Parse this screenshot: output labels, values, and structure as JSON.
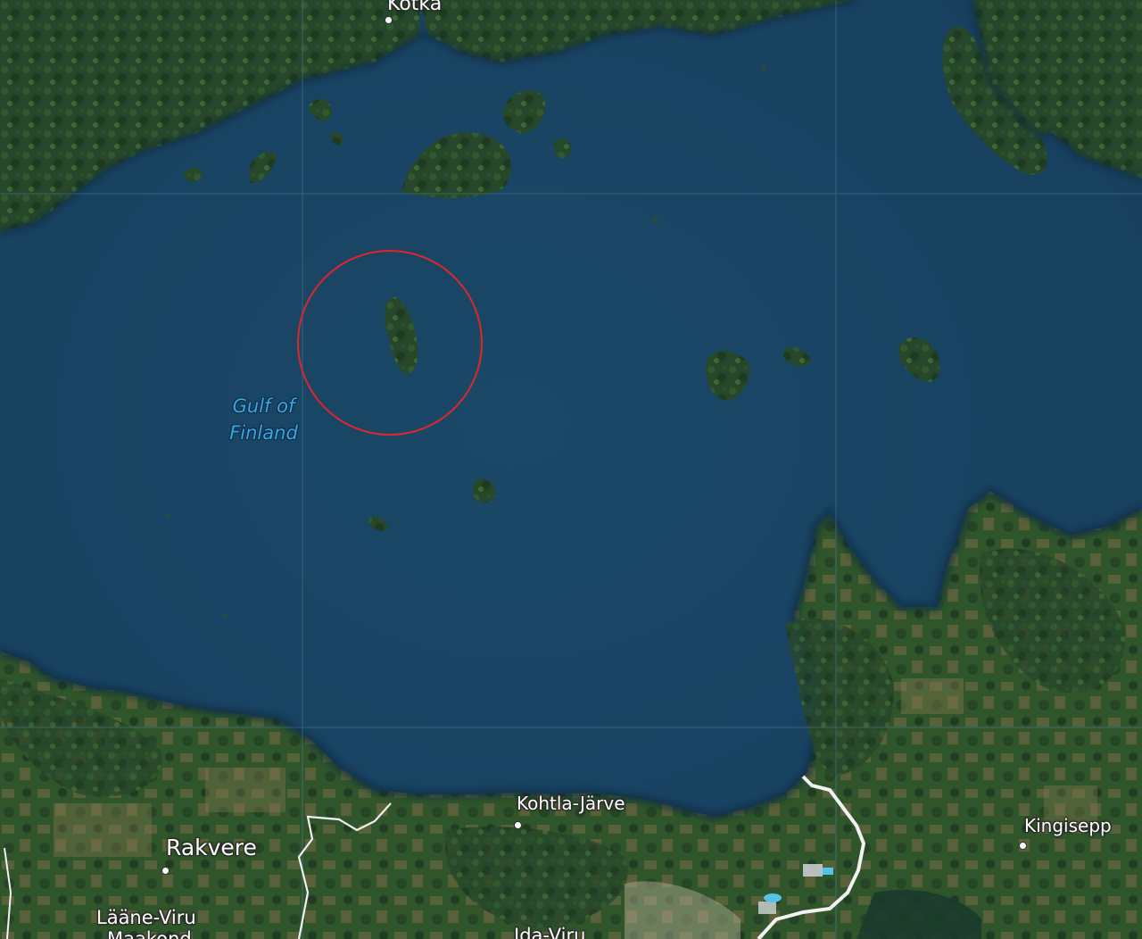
{
  "map": {
    "style": "satellite imagery with reference labels",
    "colors": {
      "water": "#1a4566",
      "land_dark": "#1f3a20",
      "land_mid": "#2e5a2a",
      "land_light": "#4f6e38",
      "farmland": "#7a6b46",
      "roads": "#f2f2f2",
      "graticule": "#4f7d9a",
      "water_label": "#38a7e6",
      "highlight_ring": "#e0252b"
    },
    "water_label": {
      "line1": "Gulf of",
      "line2": "Finland"
    },
    "places": {
      "kotka": "Kotka",
      "kohtla_jarve": "Kohtla-Järve",
      "rakvere": "Rakvere",
      "kingisepp": "Kingisepp",
      "laane_viru": "Lääne-Viru",
      "laane_viru_line2": "Maakond",
      "ida_viru": "Ida-Viru"
    },
    "highlight": {
      "shape": "circle",
      "target": "island"
    }
  }
}
